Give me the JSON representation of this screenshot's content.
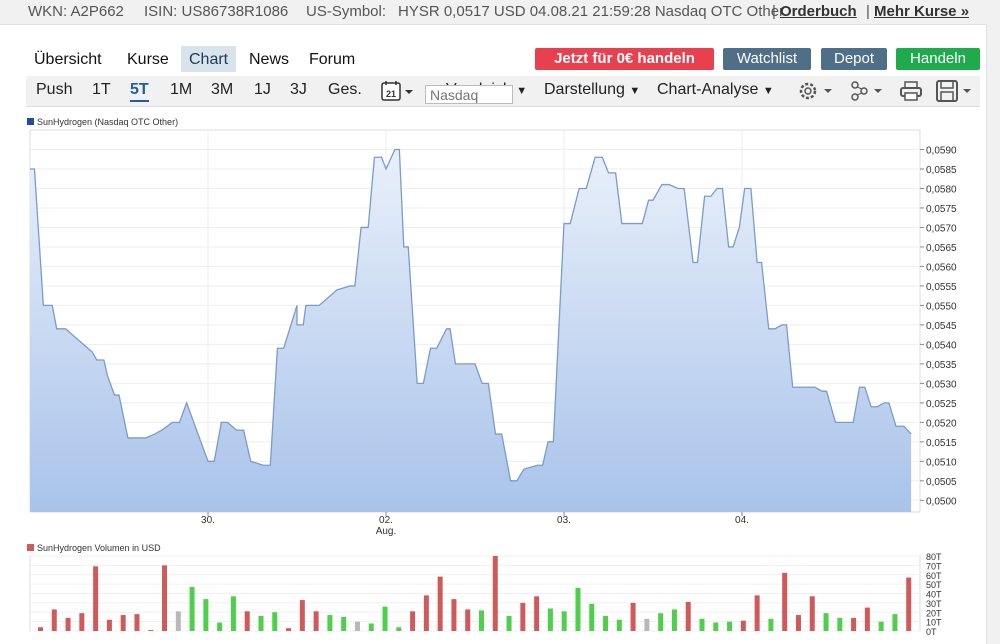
{
  "info": {
    "wkn": "WKN: A2P662",
    "isin": "ISIN: US86738R1086",
    "us_symbol": "US-Symbol:",
    "overlap": "HYSR 0,0517 USD 04.08.21 21:59:28 Nasdaq OTC Other",
    "separator1": "|",
    "orderbuch": "Orderbuch",
    "separator2": "|",
    "mehr_kurse": "Mehr Kurse »"
  },
  "tabs": [
    "Übersicht",
    "Kurse",
    "Chart",
    "News",
    "Forum"
  ],
  "active_tab": "Chart",
  "buttons": {
    "trade_free": "Jetzt für 0€ handeln",
    "watchlist": "Watchlist",
    "depot": "Depot",
    "handeln": "Handeln"
  },
  "colors": {
    "trade_free": "#e8404f",
    "watchlist": "#4f6e87",
    "depot": "#4f6e87",
    "handeln": "#1faa4e",
    "price_line": "#7a9cc8",
    "area_top": "#e9f0fa",
    "area_bottom": "#a9c3ea",
    "vol_up": "#4ed04a",
    "vol_down": "#d05a5a",
    "vol_flat": "#b8b8b8"
  },
  "toolbar": {
    "periods": [
      "Push",
      "1T",
      "5T",
      "1M",
      "3M",
      "1J",
      "3J",
      "Ges."
    ],
    "active_period": "5T",
    "calendar_day": "21",
    "vergleich": "Vergleich",
    "vergleich_placeholder": "Nasdaq",
    "darstellung": "Darstellung",
    "chart_analyse": "Chart-Analyse",
    "icons": [
      "settings-gear-icon",
      "indicators-icon",
      "print-icon",
      "save-icon"
    ]
  },
  "chart_data": [
    {
      "type": "area",
      "legend": "SunHydrogen (Nasdaq OTC Other)",
      "ylim": [
        0.0497,
        0.0595
      ],
      "y_ticks": [
        "0,0500",
        "0,0505",
        "0,0510",
        "0,0515",
        "0,0520",
        "0,0525",
        "0,0530",
        "0,0535",
        "0,0540",
        "0,0545",
        "0,0550",
        "0,0555",
        "0,0560",
        "0,0565",
        "0,0570",
        "0,0575",
        "0,0580",
        "0,0585",
        "0,0590"
      ],
      "x_ticks": [
        {
          "label": "30.",
          "sub": "",
          "x": 0.2
        },
        {
          "label": "02.",
          "sub": "Aug.",
          "x": 0.4
        },
        {
          "label": "03.",
          "sub": "",
          "x": 0.6
        },
        {
          "label": "04.",
          "sub": "",
          "x": 0.8
        }
      ],
      "points": [
        [
          0,
          0.0585
        ],
        [
          0.005,
          0.0585
        ],
        [
          0.015,
          0.055
        ],
        [
          0.025,
          0.055
        ],
        [
          0.03,
          0.0544
        ],
        [
          0.04,
          0.0544
        ],
        [
          0.05,
          0.0542
        ],
        [
          0.06,
          0.054
        ],
        [
          0.07,
          0.0538
        ],
        [
          0.075,
          0.0536
        ],
        [
          0.083,
          0.0536
        ],
        [
          0.087,
          0.0532
        ],
        [
          0.095,
          0.0527
        ],
        [
          0.1,
          0.0527
        ],
        [
          0.11,
          0.0516
        ],
        [
          0.12,
          0.0516
        ],
        [
          0.13,
          0.0516
        ],
        [
          0.14,
          0.0517
        ],
        [
          0.148,
          0.0518
        ],
        [
          0.16,
          0.052
        ],
        [
          0.168,
          0.052
        ],
        [
          0.176,
          0.0525
        ],
        [
          0.2,
          0.051
        ],
        [
          0.207,
          0.051
        ],
        [
          0.215,
          0.052
        ],
        [
          0.222,
          0.052
        ],
        [
          0.232,
          0.0518
        ],
        [
          0.24,
          0.0518
        ],
        [
          0.248,
          0.051
        ],
        [
          0.262,
          0.0509
        ],
        [
          0.27,
          0.0509
        ],
        [
          0.278,
          0.0539
        ],
        [
          0.285,
          0.0539
        ],
        [
          0.3,
          0.055
        ],
        [
          0.3,
          0.0545
        ],
        [
          0.307,
          0.0545
        ],
        [
          0.31,
          0.055
        ],
        [
          0.325,
          0.055
        ],
        [
          0.345,
          0.0554
        ],
        [
          0.36,
          0.0555
        ],
        [
          0.365,
          0.0555
        ],
        [
          0.372,
          0.057
        ],
        [
          0.38,
          0.057
        ],
        [
          0.387,
          0.0588
        ],
        [
          0.395,
          0.0588
        ],
        [
          0.4,
          0.0585
        ],
        [
          0.41,
          0.059
        ],
        [
          0.415,
          0.059
        ],
        [
          0.42,
          0.0565
        ],
        [
          0.425,
          0.0565
        ],
        [
          0.435,
          0.053
        ],
        [
          0.442,
          0.053
        ],
        [
          0.45,
          0.0539
        ],
        [
          0.457,
          0.0539
        ],
        [
          0.468,
          0.0544
        ],
        [
          0.472,
          0.0544
        ],
        [
          0.478,
          0.0535
        ],
        [
          0.5,
          0.0535
        ],
        [
          0.508,
          0.053
        ],
        [
          0.515,
          0.053
        ],
        [
          0.523,
          0.0517
        ],
        [
          0.53,
          0.0517
        ],
        [
          0.54,
          0.0505
        ],
        [
          0.547,
          0.0505
        ],
        [
          0.555,
          0.0508
        ],
        [
          0.57,
          0.0509
        ],
        [
          0.576,
          0.0509
        ],
        [
          0.582,
          0.0515
        ],
        [
          0.588,
          0.0515
        ],
        [
          0.6,
          0.0571
        ],
        [
          0.607,
          0.0571
        ],
        [
          0.617,
          0.058
        ],
        [
          0.625,
          0.058
        ],
        [
          0.635,
          0.0588
        ],
        [
          0.643,
          0.0588
        ],
        [
          0.65,
          0.0584
        ],
        [
          0.658,
          0.0584
        ],
        [
          0.665,
          0.0571
        ],
        [
          0.688,
          0.0571
        ],
        [
          0.695,
          0.0577
        ],
        [
          0.7,
          0.0577
        ],
        [
          0.71,
          0.0581
        ],
        [
          0.718,
          0.0581
        ],
        [
          0.728,
          0.058
        ],
        [
          0.735,
          0.058
        ],
        [
          0.745,
          0.0561
        ],
        [
          0.75,
          0.0561
        ],
        [
          0.758,
          0.0578
        ],
        [
          0.765,
          0.0578
        ],
        [
          0.772,
          0.058
        ],
        [
          0.778,
          0.058
        ],
        [
          0.785,
          0.0565
        ],
        [
          0.79,
          0.0565
        ],
        [
          0.797,
          0.057
        ],
        [
          0.803,
          0.058
        ],
        [
          0.81,
          0.058
        ],
        [
          0.817,
          0.0561
        ],
        [
          0.822,
          0.0561
        ],
        [
          0.83,
          0.0544
        ],
        [
          0.837,
          0.0544
        ],
        [
          0.845,
          0.0545
        ],
        [
          0.85,
          0.0545
        ],
        [
          0.857,
          0.0529
        ],
        [
          0.865,
          0.0529
        ],
        [
          0.875,
          0.0529
        ],
        [
          0.882,
          0.0529
        ],
        [
          0.89,
          0.0528
        ],
        [
          0.895,
          0.0528
        ],
        [
          0.905,
          0.052
        ],
        [
          0.925,
          0.052
        ],
        [
          0.932,
          0.0529
        ],
        [
          0.938,
          0.0529
        ],
        [
          0.945,
          0.0524
        ],
        [
          0.952,
          0.0524
        ],
        [
          0.96,
          0.0525
        ],
        [
          0.965,
          0.0525
        ],
        [
          0.973,
          0.0519
        ],
        [
          0.982,
          0.0519
        ],
        [
          0.99,
          0.0517
        ]
      ]
    },
    {
      "type": "bar",
      "legend": "SunHydrogen Volumen in USD",
      "ylim": [
        0,
        80
      ],
      "y_ticks": [
        "0T",
        "10T",
        "20T",
        "30T",
        "40T",
        "50T",
        "60T",
        "70T",
        "80T"
      ],
      "values": [
        [
          4,
          "d"
        ],
        [
          23,
          "d"
        ],
        [
          14,
          "d"
        ],
        [
          19,
          "d"
        ],
        [
          69,
          "d"
        ],
        [
          12,
          "d"
        ],
        [
          17,
          "d"
        ],
        [
          18,
          "d"
        ],
        [
          1,
          "d"
        ],
        [
          70,
          "d"
        ],
        [
          21,
          "f"
        ],
        [
          47,
          "u"
        ],
        [
          34,
          "u"
        ],
        [
          9,
          "u"
        ],
        [
          37,
          "u"
        ],
        [
          21,
          "d"
        ],
        [
          16,
          "u"
        ],
        [
          20,
          "u"
        ],
        [
          3,
          "d"
        ],
        [
          33,
          "d"
        ],
        [
          21,
          "d"
        ],
        [
          17,
          "u"
        ],
        [
          15,
          "u"
        ],
        [
          10,
          "f"
        ],
        [
          8,
          "u"
        ],
        [
          26,
          "u"
        ],
        [
          4,
          "u"
        ],
        [
          21,
          "d"
        ],
        [
          38,
          "d"
        ],
        [
          58,
          "d"
        ],
        [
          34,
          "d"
        ],
        [
          23,
          "d"
        ],
        [
          22,
          "u"
        ],
        [
          80,
          "d"
        ],
        [
          16,
          "u"
        ],
        [
          30,
          "d"
        ],
        [
          37,
          "d"
        ],
        [
          24,
          "u"
        ],
        [
          21,
          "u"
        ],
        [
          46,
          "u"
        ],
        [
          29,
          "u"
        ],
        [
          16,
          "u"
        ],
        [
          12,
          "u"
        ],
        [
          30,
          "d"
        ],
        [
          13,
          "f"
        ],
        [
          19,
          "u"
        ],
        [
          23,
          "u"
        ],
        [
          31,
          "d"
        ],
        [
          13,
          "u"
        ],
        [
          9,
          "u"
        ],
        [
          10,
          "u"
        ],
        [
          11,
          "d"
        ],
        [
          38,
          "d"
        ],
        [
          13,
          "u"
        ],
        [
          62,
          "d"
        ],
        [
          17,
          "d"
        ],
        [
          37,
          "d"
        ],
        [
          19,
          "u"
        ],
        [
          14,
          "u"
        ],
        [
          14,
          "d"
        ],
        [
          25,
          "d"
        ],
        [
          10,
          "u"
        ],
        [
          18,
          "u"
        ],
        [
          57,
          "d"
        ]
      ]
    }
  ]
}
